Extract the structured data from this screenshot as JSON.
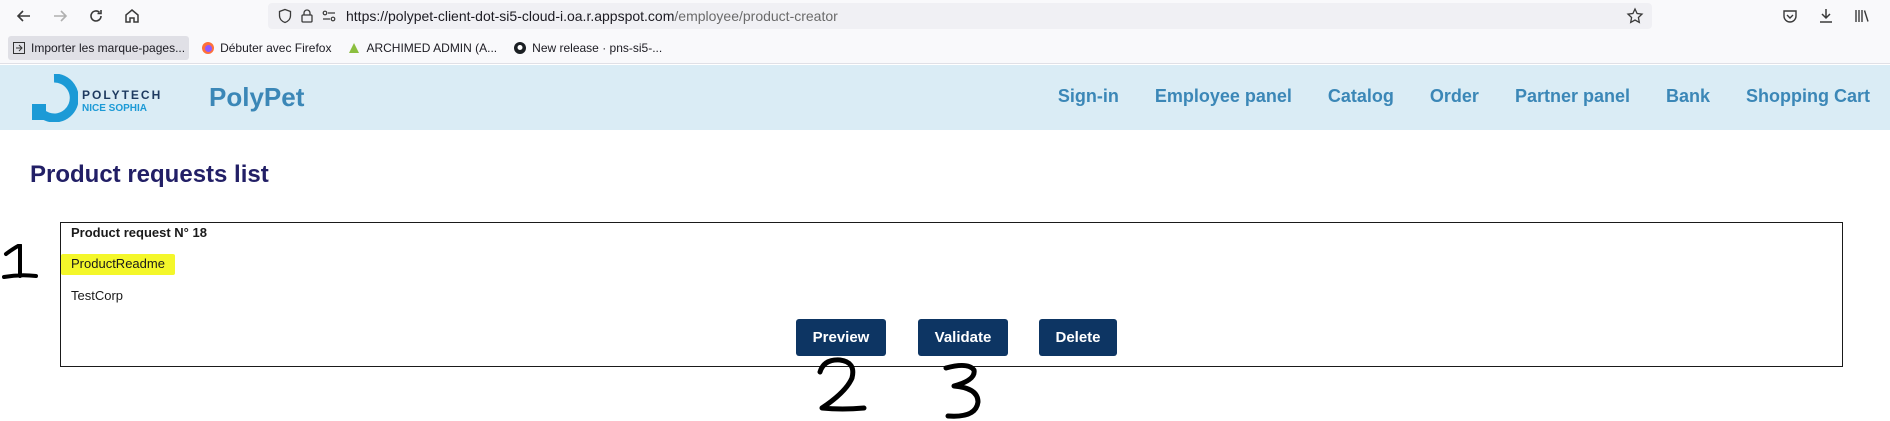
{
  "browser": {
    "url_host": "https://polypet-client-dot-si5-cloud-i.oa.r.appspot.com",
    "url_path": "/employee/product-creator",
    "bookmarks": [
      {
        "label": "Importer les marque-pages..."
      },
      {
        "label": "Débuter avec Firefox"
      },
      {
        "label": "ARCHIMED ADMIN (A..."
      },
      {
        "label": "New release · pns-si5-..."
      }
    ]
  },
  "header": {
    "logo_line1": "POLYTECH",
    "logo_line2": "NICE SOPHIA",
    "brand": "PolyPet",
    "nav": [
      {
        "label": "Sign-in"
      },
      {
        "label": "Employee panel"
      },
      {
        "label": "Catalog"
      },
      {
        "label": "Order"
      },
      {
        "label": "Partner panel"
      },
      {
        "label": "Bank"
      },
      {
        "label": "Shopping Cart"
      }
    ]
  },
  "main": {
    "title": "Product requests list",
    "request": {
      "title": "Product request N° 18",
      "name": "ProductReadme",
      "company": "TestCorp",
      "buttons": {
        "preview": "Preview",
        "validate": "Validate",
        "delete": "Delete"
      }
    }
  },
  "annotations": {
    "one": "1",
    "two": "2",
    "three": "3"
  },
  "colors": {
    "header_bg": "#daecf5",
    "nav_text": "#3b87b7",
    "title": "#221f66",
    "button_bg": "#0d3563",
    "highlight": "#f4f72a"
  }
}
